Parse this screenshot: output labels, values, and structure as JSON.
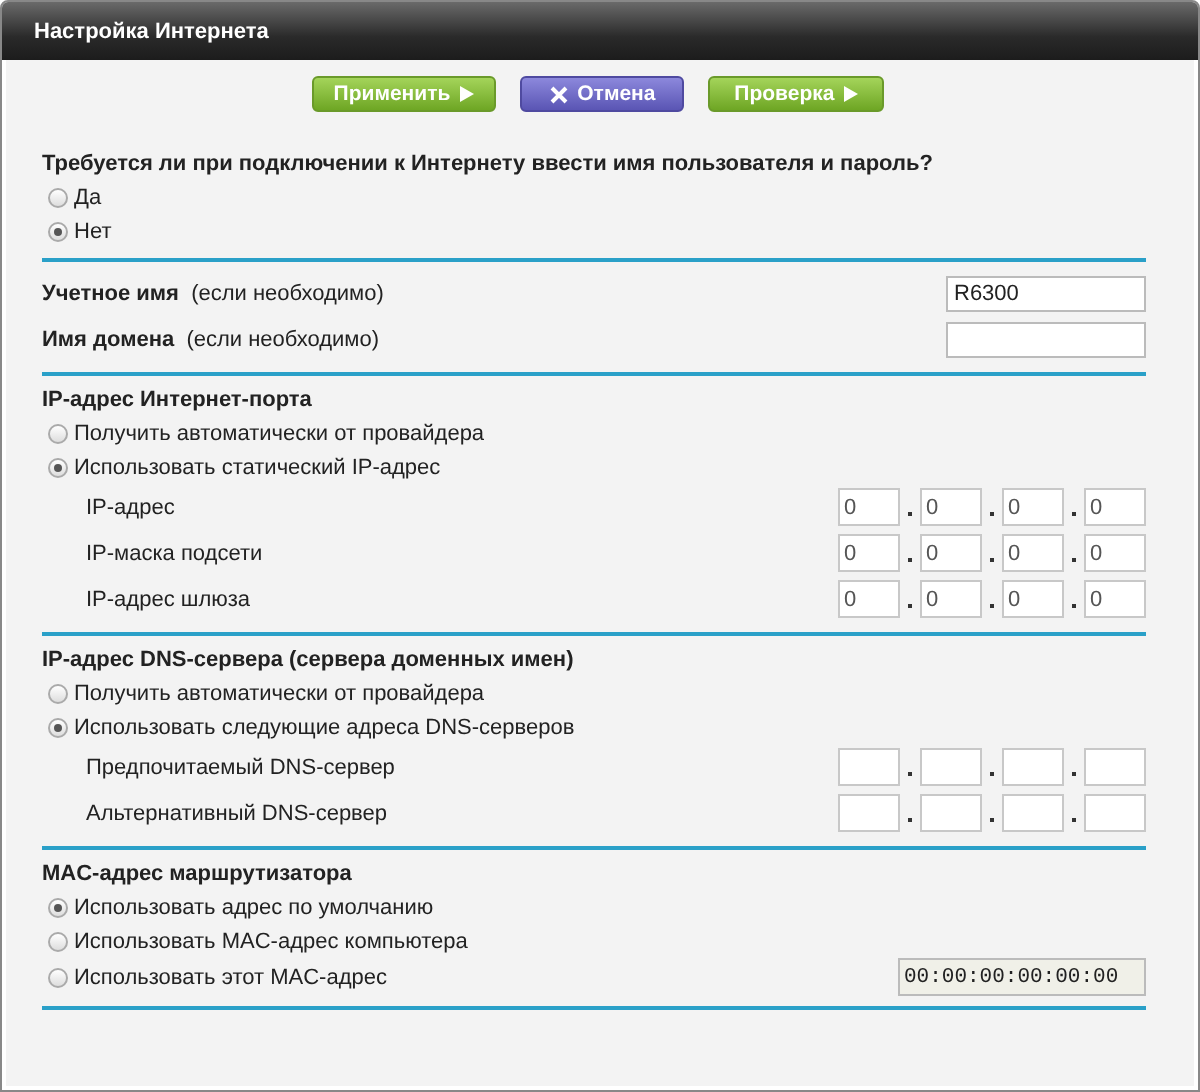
{
  "window": {
    "title": "Настройка Интернета"
  },
  "buttons": [
    {
      "label": "Применить",
      "kind": "apply"
    },
    {
      "label": "Отмена",
      "kind": "cancel"
    },
    {
      "label": "Проверка",
      "kind": "apply"
    }
  ],
  "sections": [
    {
      "kind": "question",
      "title": "Требуется ли при подключении к Интернету ввести имя пользователя и пароль?",
      "options": [
        {
          "label": "Да",
          "selected": false
        },
        {
          "label": "Нет",
          "selected": true
        }
      ]
    },
    {
      "kind": "fields",
      "fields": [
        {
          "label": "Учетное имя",
          "hint": "(если необходимо)",
          "value": "R6300"
        },
        {
          "label": "Имя домена",
          "hint": "(если необходимо)"
        }
      ]
    },
    {
      "kind": "address",
      "title": "IP-адрес Интернет-порта",
      "options": [
        {
          "label": "Получить автоматически от провайдера",
          "selected": false
        },
        {
          "label": "Использовать статический IP-адрес",
          "selected": true
        }
      ],
      "rows": [
        {
          "label": "IP-адрес",
          "octets": [
            "0",
            "0",
            "0",
            "0"
          ]
        },
        {
          "label": "IP-маска подсети",
          "octets": [
            "0",
            "0",
            "0",
            "0"
          ]
        },
        {
          "label": "IP-адрес шлюза",
          "octets": [
            "0",
            "0",
            "0",
            "0"
          ]
        }
      ]
    },
    {
      "kind": "address",
      "title": "IP-адрес DNS-сервера (сервера доменных имен)",
      "options": [
        {
          "label": "Получить автоматически от провайдера",
          "selected": false
        },
        {
          "label": "Использовать следующие адреса DNS-серверов",
          "selected": true
        }
      ],
      "rows": [
        {
          "label": "Предпочитаемый DNS-сервер"
        },
        {
          "label": "Альтернативный DNS-сервер"
        }
      ]
    },
    {
      "kind": "address",
      "title": "MAC-адрес маршрутизатора",
      "options": [
        {
          "label": "Использовать адрес по умолчанию",
          "selected": true
        },
        {
          "label": "Использовать MAC-адрес компьютера",
          "selected": false
        },
        {
          "label": "Использовать этот MAC-адрес",
          "selected": false,
          "mac": "00:00:00:00:00:00"
        }
      ]
    }
  ]
}
